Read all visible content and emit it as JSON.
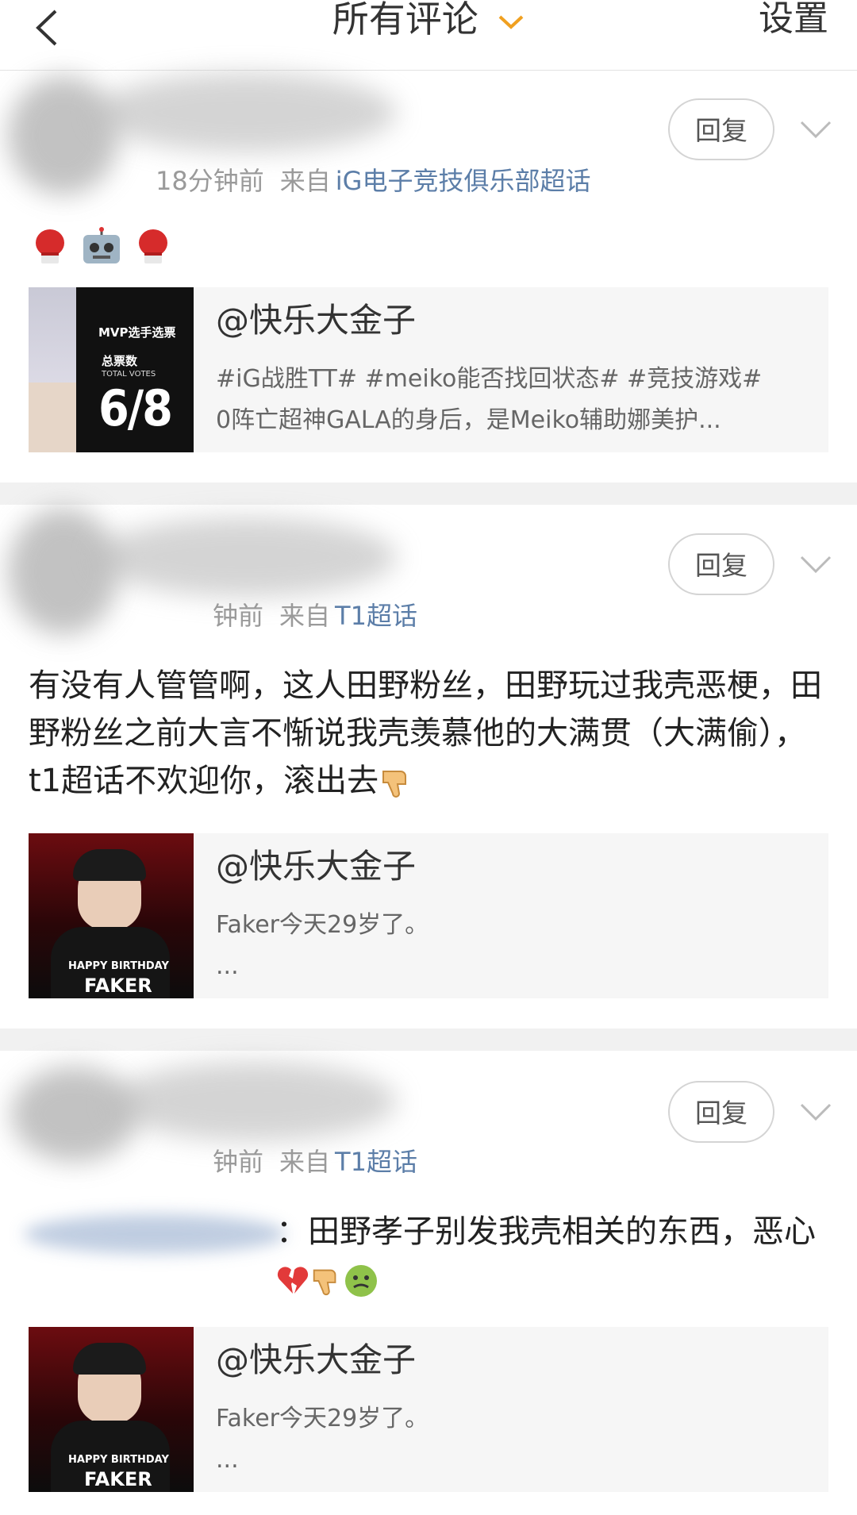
{
  "header": {
    "title": "所有评论",
    "settings": "设置"
  },
  "actions": {
    "reply": "回复"
  },
  "comments": [
    {
      "time": "18分钟前",
      "from": "来自",
      "topic": "iG电子竞技俱乐部超话",
      "text": "",
      "card": {
        "author": "@快乐大金子",
        "line1": "#iG战胜TT# #meiko能否找回状态# #竞技游戏#",
        "line2": "0阵亡超神GALA的身后，是Meiko辅助娜美护...",
        "thumb": {
          "label1": "MVP选手选票",
          "label2": "总票数",
          "label3": "TOTAL VOTES",
          "big": "6/8"
        }
      }
    },
    {
      "time": "钟前",
      "from": "来自",
      "topic": "T1超话",
      "text": "有没有人管管啊，这人田野粉丝，田野玩过我壳恶梗，田野粉丝之前大言不惭说我壳羡慕他的大满贯（大满偷），t1超话不欢迎你，滚出去",
      "card": {
        "author": "@快乐大金子",
        "line1": "Faker今天29岁了。",
        "line2": "...",
        "thumb": {
          "label1": "HAPPY BIRTHDAY",
          "label2": "FAKER"
        }
      }
    },
    {
      "time": "钟前",
      "from": "来自",
      "topic": "T1超话",
      "text": "：田野孝子别发我壳相关的东西，恶心",
      "card": {
        "author": "@快乐大金子",
        "line1": "Faker今天29岁了。",
        "line2": "...",
        "thumb": {
          "label1": "HAPPY BIRTHDAY",
          "label2": "FAKER"
        }
      }
    }
  ],
  "colors": {
    "topic": "#5c7ea8",
    "separator": "#f1f1f1",
    "chevron": "#f0a020"
  }
}
